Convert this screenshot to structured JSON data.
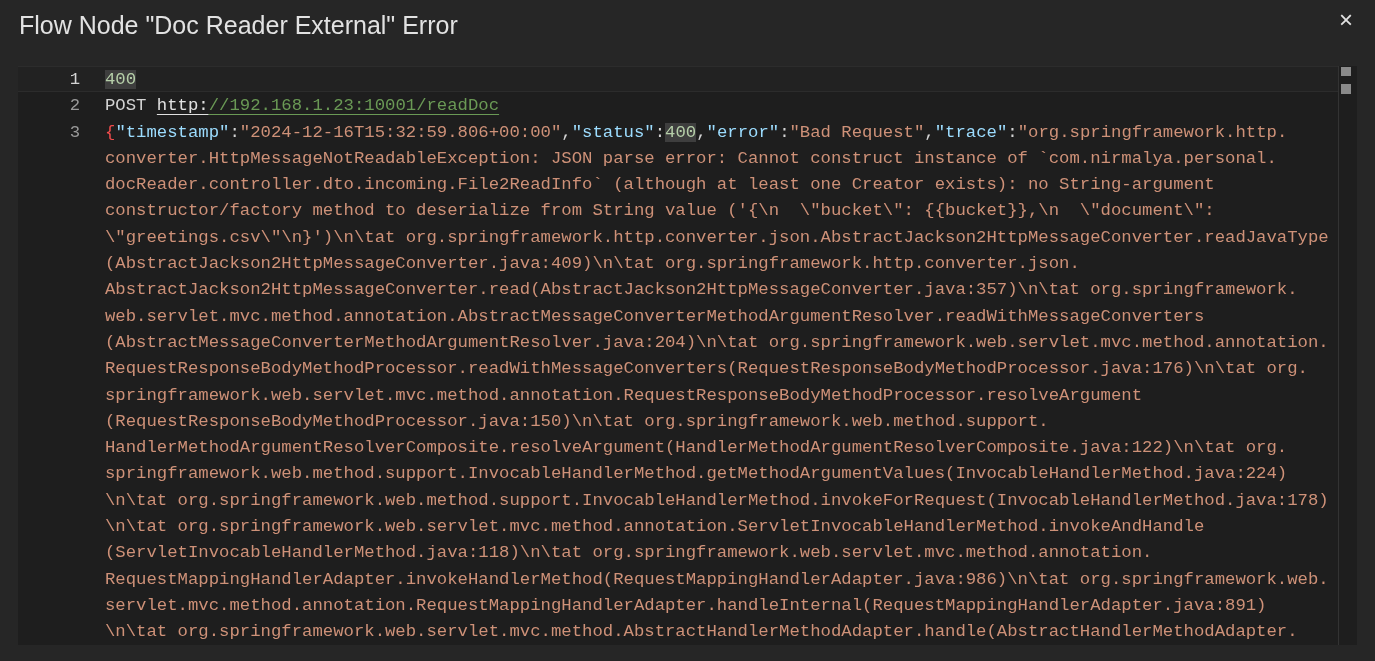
{
  "dialog": {
    "title": "Flow Node \"Doc Reader External\" Error",
    "close": "×"
  },
  "editor": {
    "lines": [
      {
        "number": "1",
        "current": true,
        "rows": [
          [
            {
              "kind": "number",
              "text": "400",
              "highlighted": true
            }
          ]
        ]
      },
      {
        "number": "2",
        "current": false,
        "rows": [
          [
            {
              "kind": "plain",
              "text": "POST "
            },
            {
              "kind": "link",
              "scheme": "http:",
              "rest": "//192.168.1.23:10001/readDoc"
            }
          ]
        ]
      },
      {
        "number": "3",
        "current": false,
        "rows": [
          [
            {
              "kind": "brace",
              "text": "{"
            },
            {
              "kind": "key",
              "text": "\"timestamp\""
            },
            {
              "kind": "punct",
              "text": ":"
            },
            {
              "kind": "string",
              "text": "\"2024-12-16T15:32:59.806+00:00\""
            },
            {
              "kind": "punct",
              "text": ","
            },
            {
              "kind": "key",
              "text": "\"status\""
            },
            {
              "kind": "punct",
              "text": ":"
            },
            {
              "kind": "number",
              "text": "400",
              "highlighted": true
            },
            {
              "kind": "punct",
              "text": ","
            },
            {
              "kind": "key",
              "text": "\"error\""
            },
            {
              "kind": "punct",
              "text": ":"
            },
            {
              "kind": "string",
              "text": "\"Bad Request\""
            },
            {
              "kind": "punct",
              "text": ","
            },
            {
              "kind": "key",
              "text": "\"trace\""
            },
            {
              "kind": "punct",
              "text": ":"
            },
            {
              "kind": "string",
              "text": "\"org.springframework.http."
            }
          ],
          [
            {
              "kind": "string",
              "text": "converter.HttpMessageNotReadableException: JSON parse error: Cannot construct instance of `com.nirmalya.personal."
            }
          ],
          [
            {
              "kind": "string",
              "text": "docReader.controller.dto.incoming.File2ReadInfo` (although at least one Creator exists): no String-argument"
            }
          ],
          [
            {
              "kind": "string",
              "text": "constructor/factory method to deserialize from String value ('{\\n  \\\"bucket\\\": {{bucket}},\\n  \\\"document\\\":"
            }
          ],
          [
            {
              "kind": "string",
              "text": "\\\"greetings.csv\\\"\\n}')\\n\\tat org.springframework.http.converter.json.AbstractJackson2HttpMessageConverter.readJavaType"
            }
          ],
          [
            {
              "kind": "string",
              "text": "(AbstractJackson2HttpMessageConverter.java:409)\\n\\tat org.springframework.http.converter.json."
            }
          ],
          [
            {
              "kind": "string",
              "text": "AbstractJackson2HttpMessageConverter.read(AbstractJackson2HttpMessageConverter.java:357)\\n\\tat org.springframework."
            }
          ],
          [
            {
              "kind": "string",
              "text": "web.servlet.mvc.method.annotation.AbstractMessageConverterMethodArgumentResolver.readWithMessageConverters"
            }
          ],
          [
            {
              "kind": "string",
              "text": "(AbstractMessageConverterMethodArgumentResolver.java:204)\\n\\tat org.springframework.web.servlet.mvc.method.annotation."
            }
          ],
          [
            {
              "kind": "string",
              "text": "RequestResponseBodyMethodProcessor.readWithMessageConverters(RequestResponseBodyMethodProcessor.java:176)\\n\\tat org."
            }
          ],
          [
            {
              "kind": "string",
              "text": "springframework.web.servlet.mvc.method.annotation.RequestResponseBodyMethodProcessor.resolveArgument"
            }
          ],
          [
            {
              "kind": "string",
              "text": "(RequestResponseBodyMethodProcessor.java:150)\\n\\tat org.springframework.web.method.support."
            }
          ],
          [
            {
              "kind": "string",
              "text": "HandlerMethodArgumentResolverComposite.resolveArgument(HandlerMethodArgumentResolverComposite.java:122)\\n\\tat org."
            }
          ],
          [
            {
              "kind": "string",
              "text": "springframework.web.method.support.InvocableHandlerMethod.getMethodArgumentValues(InvocableHandlerMethod.java:224)"
            }
          ],
          [
            {
              "kind": "string",
              "text": "\\n\\tat org.springframework.web.method.support.InvocableHandlerMethod.invokeForRequest(InvocableHandlerMethod.java:178)"
            }
          ],
          [
            {
              "kind": "string",
              "text": "\\n\\tat org.springframework.web.servlet.mvc.method.annotation.ServletInvocableHandlerMethod.invokeAndHandle"
            }
          ],
          [
            {
              "kind": "string",
              "text": "(ServletInvocableHandlerMethod.java:118)\\n\\tat org.springframework.web.servlet.mvc.method.annotation."
            }
          ],
          [
            {
              "kind": "string",
              "text": "RequestMappingHandlerAdapter.invokeHandlerMethod(RequestMappingHandlerAdapter.java:986)\\n\\tat org.springframework.web."
            }
          ],
          [
            {
              "kind": "string",
              "text": "servlet.mvc.method.annotation.RequestMappingHandlerAdapter.handleInternal(RequestMappingHandlerAdapter.java:891)"
            }
          ],
          [
            {
              "kind": "string",
              "text": "\\n\\tat org.springframework.web.servlet.mvc.method.AbstractHandlerMethodAdapter.handle(AbstractHandlerMethodAdapter."
            }
          ]
        ]
      }
    ]
  }
}
